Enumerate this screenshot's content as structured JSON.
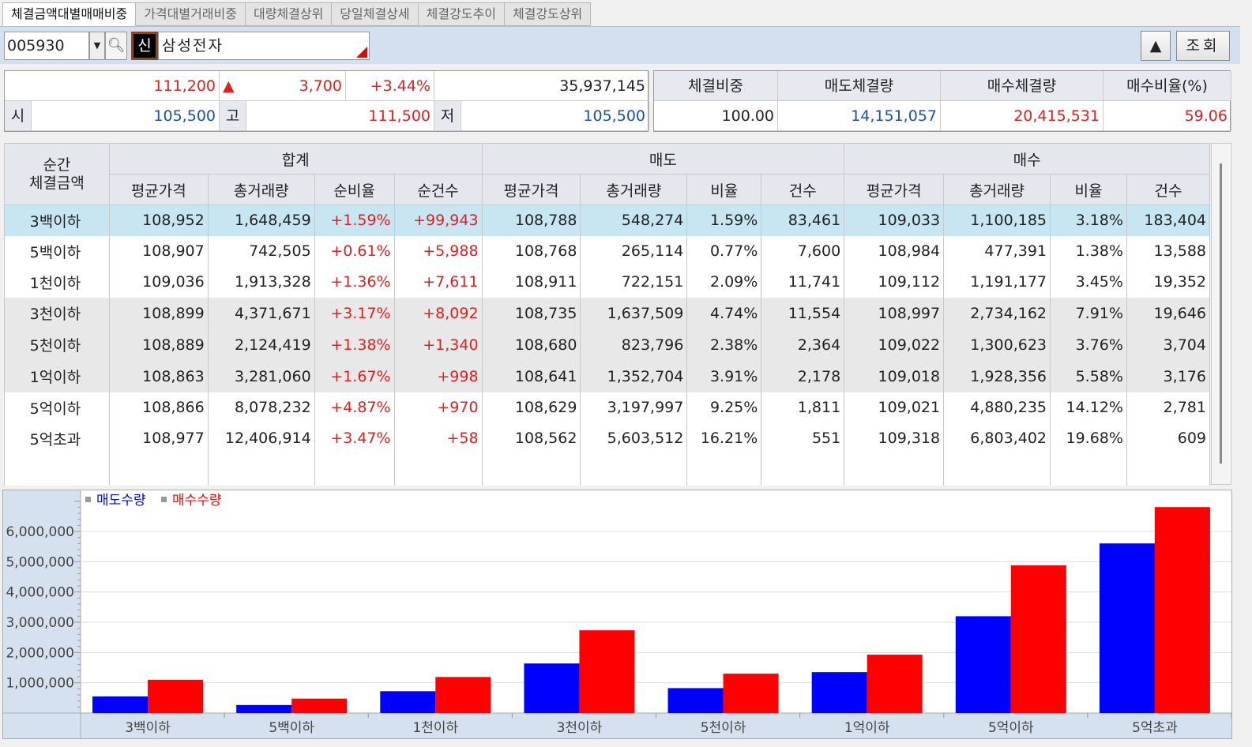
{
  "tabs": [
    "체결금액대별매매비중",
    "가격대별거래비중",
    "대량체결상위",
    "당일체결상세",
    "체결강도추이",
    "체결강도상위"
  ],
  "toolbar": {
    "code": "005930",
    "shin": "신",
    "stock_name": "삼성전자",
    "up_button": "▲",
    "query_button": "조회"
  },
  "quote": {
    "price": "111,200",
    "change_arrow": "▲",
    "change": "3,700",
    "change_pct": "+3.44%",
    "volume": "35,937,145",
    "open_label": "시",
    "open": "105,500",
    "high_label": "고",
    "high": "111,500",
    "low_label": "저",
    "low": "105,500"
  },
  "summary": {
    "headers": [
      "체결비중",
      "매도체결량",
      "매수체결량",
      "매수비율(%)"
    ],
    "values": [
      "100.00",
      "14,151,057",
      "20,415,531",
      "59.06"
    ]
  },
  "table": {
    "corner": [
      "순간",
      "체결금액"
    ],
    "groups": [
      "합계",
      "매도",
      "매수"
    ],
    "columns": [
      "평균가격",
      "총거래량",
      "순비율",
      "순건수",
      "평균가격",
      "총거래량",
      "비율",
      "건수",
      "평균가격",
      "총거래량",
      "비율",
      "건수"
    ],
    "rows": [
      [
        "3백이하",
        "108,952",
        "1,648,459",
        "+1.59%",
        "+99,943",
        "108,788",
        "548,274",
        "1.59%",
        "83,461",
        "109,033",
        "1,100,185",
        "3.18%",
        "183,404"
      ],
      [
        "5백이하",
        "108,907",
        "742,505",
        "+0.61%",
        "+5,988",
        "108,768",
        "265,114",
        "0.77%",
        "7,600",
        "108,984",
        "477,391",
        "1.38%",
        "13,588"
      ],
      [
        "1천이하",
        "109,036",
        "1,913,328",
        "+1.36%",
        "+7,611",
        "108,911",
        "722,151",
        "2.09%",
        "11,741",
        "109,112",
        "1,191,177",
        "3.45%",
        "19,352"
      ],
      [
        "3천이하",
        "108,899",
        "4,371,671",
        "+3.17%",
        "+8,092",
        "108,735",
        "1,637,509",
        "4.74%",
        "11,554",
        "108,997",
        "2,734,162",
        "7.91%",
        "19,646"
      ],
      [
        "5천이하",
        "108,889",
        "2,124,419",
        "+1.38%",
        "+1,340",
        "108,680",
        "823,796",
        "2.38%",
        "2,364",
        "109,022",
        "1,300,623",
        "3.76%",
        "3,704"
      ],
      [
        "1억이하",
        "108,863",
        "3,281,060",
        "+1.67%",
        "+998",
        "108,641",
        "1,352,704",
        "3.91%",
        "2,178",
        "109,018",
        "1,928,356",
        "5.58%",
        "3,176"
      ],
      [
        "5억이하",
        "108,866",
        "8,078,232",
        "+4.87%",
        "+970",
        "108,629",
        "3,197,997",
        "9.25%",
        "1,811",
        "109,021",
        "4,880,235",
        "14.12%",
        "2,781"
      ],
      [
        "5억초과",
        "108,977",
        "12,406,914",
        "+3.47%",
        "+58",
        "108,562",
        "5,603,512",
        "16.21%",
        "551",
        "109,318",
        "6,803,402",
        "19.68%",
        "609"
      ]
    ]
  },
  "chart_data": {
    "type": "bar",
    "categories": [
      "3백이하",
      "5백이하",
      "1천이하",
      "3천이하",
      "5천이하",
      "1억이하",
      "5억이하",
      "5억초과"
    ],
    "series": [
      {
        "name": "매도수량",
        "color": "#0000ff",
        "values": [
          548274,
          265114,
          722151,
          1637509,
          823796,
          1352704,
          3197997,
          5603512
        ]
      },
      {
        "name": "매수수량",
        "color": "#ff0000",
        "values": [
          1100185,
          477391,
          1191177,
          2734162,
          1300623,
          1928356,
          4880235,
          6803402
        ]
      }
    ],
    "yticks": [
      "1,000,000",
      "2,000,000",
      "3,000,000",
      "4,000,000",
      "5,000,000",
      "6,000,000"
    ],
    "ylim": [
      0,
      7200000
    ],
    "legend": "top-left"
  }
}
